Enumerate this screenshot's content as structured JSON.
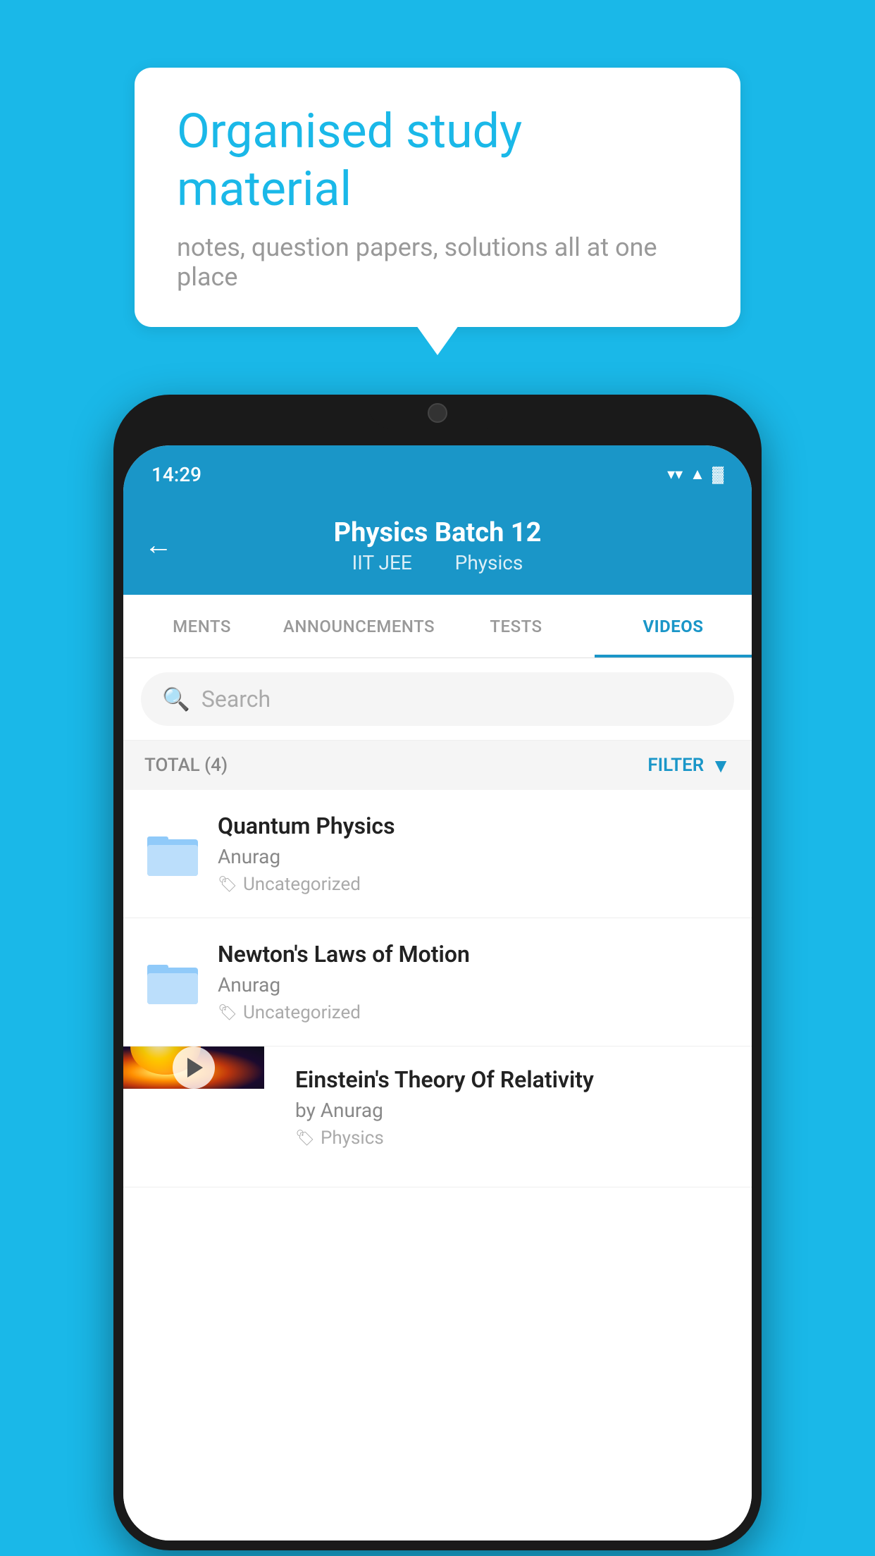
{
  "background_color": "#1ab8e8",
  "speech_bubble": {
    "title": "Organised study material",
    "subtitle": "notes, question papers, solutions all at one place"
  },
  "phone": {
    "status_bar": {
      "time": "14:29",
      "wifi": "▼",
      "signal": "▲",
      "battery": "▐"
    },
    "header": {
      "back_label": "←",
      "title": "Physics Batch 12",
      "subtitle_part1": "IIT JEE",
      "subtitle_part2": "Physics"
    },
    "tabs": [
      {
        "label": "MENTS",
        "active": false
      },
      {
        "label": "ANNOUNCEMENTS",
        "active": false
      },
      {
        "label": "TESTS",
        "active": false
      },
      {
        "label": "VIDEOS",
        "active": true
      }
    ],
    "search": {
      "placeholder": "Search"
    },
    "filter": {
      "total_label": "TOTAL (4)",
      "filter_label": "FILTER"
    },
    "videos": [
      {
        "id": 1,
        "title": "Quantum Physics",
        "author": "Anurag",
        "tag": "Uncategorized",
        "has_thumbnail": false
      },
      {
        "id": 2,
        "title": "Newton's Laws of Motion",
        "author": "Anurag",
        "tag": "Uncategorized",
        "has_thumbnail": false
      },
      {
        "id": 3,
        "title": "Einstein's Theory Of Relativity",
        "author": "by Anurag",
        "tag": "Physics",
        "has_thumbnail": true
      }
    ]
  }
}
